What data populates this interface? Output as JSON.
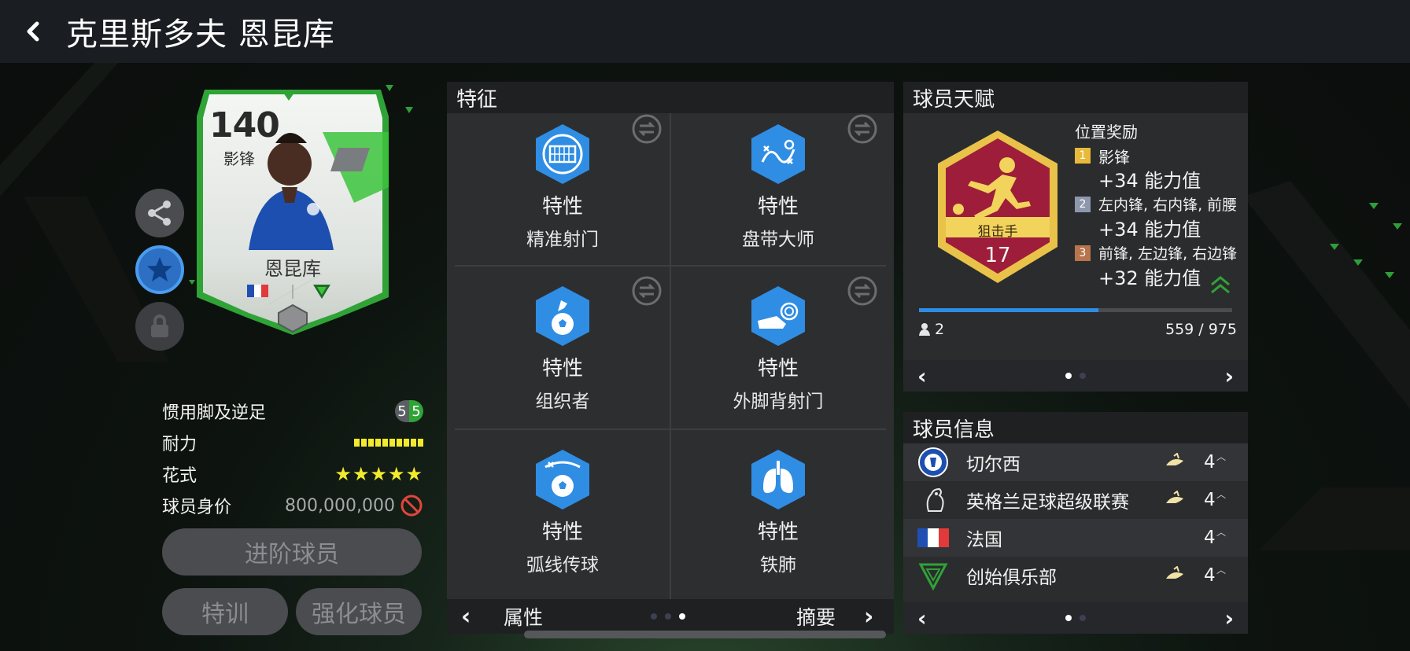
{
  "header": {
    "title": "克里斯多夫 恩昆库"
  },
  "card": {
    "rating": "140",
    "position": "影锋",
    "name": "恩昆库"
  },
  "stats": {
    "weak_foot_label": "惯用脚及逆足",
    "weak_foot_values": [
      "5",
      "5"
    ],
    "stamina_label": "耐力",
    "stamina_level": 1.0,
    "skill_label": "花式",
    "skill_stars": "★★★★★",
    "price_label": "球员身价",
    "price_value": "800,000,000"
  },
  "buttons": {
    "advance": "进阶球员",
    "train": "特训",
    "enhance": "强化球员"
  },
  "traits": {
    "title": "特征",
    "items": [
      {
        "type": "特性",
        "name": "精准射门",
        "icon": "goal-net-icon"
      },
      {
        "type": "特性",
        "name": "盘带大师",
        "icon": "dribble-path-icon"
      },
      {
        "type": "特性",
        "name": "组织者",
        "icon": "playmaker-icon"
      },
      {
        "type": "特性",
        "name": "外脚背射门",
        "icon": "boot-spin-icon"
      },
      {
        "type": "特性",
        "name": "弧线传球",
        "icon": "curve-pass-icon"
      },
      {
        "type": "特性",
        "name": "铁肺",
        "icon": "lungs-icon"
      }
    ],
    "pager_left": "属性",
    "pager_right": "摘要",
    "prev_arrow": "‹",
    "next_arrow": "›"
  },
  "talent": {
    "title": "球员天赋",
    "badge_name": "狙击手",
    "badge_level": "17",
    "bonus_title": "位置奖励",
    "bonuses": [
      {
        "rank": "1",
        "positions": "影锋",
        "value": "+34 能力值",
        "color": "#e8b93a"
      },
      {
        "rank": "2",
        "positions": "左内锋, 右内锋, 前腰",
        "value": "+34 能力值",
        "color": "#8d98ad"
      },
      {
        "rank": "3",
        "positions": "前锋, 左边锋, 右边锋",
        "value": "+32 能力值",
        "color": "#b8744d"
      }
    ],
    "progress": 0.573,
    "count": "2",
    "progress_text": "559 / 975",
    "prev_arrow": "‹",
    "next_arrow": "›"
  },
  "info": {
    "title": "球员信息",
    "rows": [
      {
        "name": "切尔西",
        "level": "4",
        "icon": "chelsea-crest-icon"
      },
      {
        "name": "英格兰足球超级联赛",
        "level": "4",
        "icon": "premier-league-icon"
      },
      {
        "name": "法国",
        "level": "4",
        "icon": "france-flag-icon"
      },
      {
        "name": "创始俱乐部",
        "level": "4",
        "icon": "founders-club-icon"
      }
    ],
    "prev_arrow": "‹",
    "next_arrow": "›"
  },
  "colors": {
    "accent_blue": "#2f8de4",
    "card_green": "#3cc43c",
    "stamina_yellow": "#f2ea2c",
    "badge_red": "#9e1d3a",
    "badge_gold": "#e9c24a"
  }
}
